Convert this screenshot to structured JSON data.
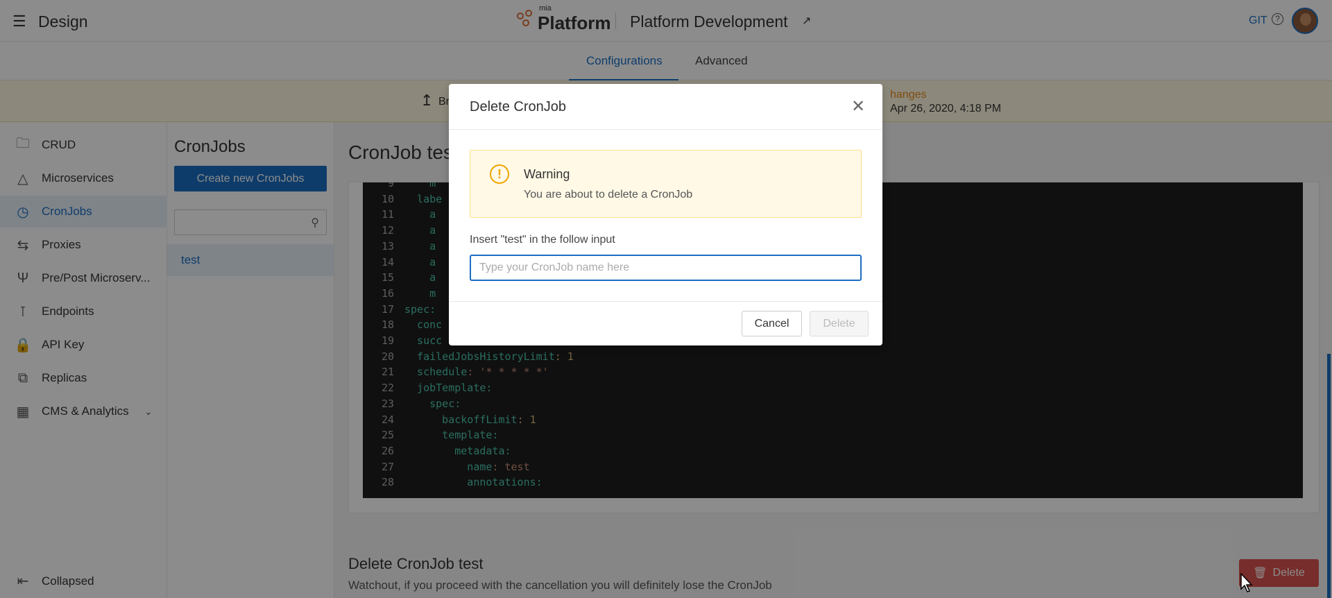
{
  "topbar": {
    "section": "Design",
    "brand_small": "mia",
    "brand": "Platform",
    "project": "Platform Development",
    "git": "GIT",
    "help": "?"
  },
  "tabs": [
    "Configurations",
    "Advanced"
  ],
  "banner": {
    "branch": "Br",
    "changes": "hanges",
    "date": "Apr 26, 2020, 4:18 PM"
  },
  "sidebar": {
    "items": [
      {
        "label": "CRUD",
        "icon": "folder-icon"
      },
      {
        "label": "Microservices",
        "icon": "microservices-icon"
      },
      {
        "label": "CronJobs",
        "icon": "clock-icon"
      },
      {
        "label": "Proxies",
        "icon": "proxy-icon"
      },
      {
        "label": "Pre/Post Microserv...",
        "icon": "fork-icon"
      },
      {
        "label": "Endpoints",
        "icon": "endpoint-icon"
      },
      {
        "label": "API Key",
        "icon": "lock-icon"
      },
      {
        "label": "Replicas",
        "icon": "copy-icon"
      },
      {
        "label": "CMS & Analytics",
        "icon": "cms-icon"
      }
    ],
    "collapsed": "Collapsed"
  },
  "cronjobs": {
    "title": "CronJobs",
    "create": "Create new CronJobs",
    "items": [
      "test"
    ]
  },
  "main": {
    "title": "CronJob tes",
    "delete_title": "Delete CronJob test",
    "delete_desc": "Watchout, if you proceed with the cancellation you will definitely lose the CronJob",
    "delete_button": "Delete"
  },
  "code": [
    {
      "n": "9",
      "indent": "    ",
      "key": "m",
      "val": ""
    },
    {
      "n": "10",
      "indent": "  ",
      "key": "labe",
      "val": ""
    },
    {
      "n": "11",
      "indent": "    ",
      "key": "a",
      "val": ""
    },
    {
      "n": "12",
      "indent": "    ",
      "key": "a",
      "val": ""
    },
    {
      "n": "13",
      "indent": "    ",
      "key": "a",
      "val": ""
    },
    {
      "n": "14",
      "indent": "    ",
      "key": "a",
      "val": ""
    },
    {
      "n": "15",
      "indent": "    ",
      "key": "a",
      "val": ""
    },
    {
      "n": "16",
      "indent": "    ",
      "key": "m",
      "val": ""
    },
    {
      "n": "17",
      "indent": "",
      "key": "spec:",
      "val": ""
    },
    {
      "n": "18",
      "indent": "  ",
      "key": "conc",
      "val": ""
    },
    {
      "n": "19",
      "indent": "  ",
      "key": "succ",
      "val": ""
    },
    {
      "n": "20",
      "indent": "  ",
      "key": "failedJobsHistoryLimit",
      "val": ": 1"
    },
    {
      "n": "21",
      "indent": "  ",
      "key": "schedule",
      "val": ": '* * * * *'"
    },
    {
      "n": "22",
      "indent": "  ",
      "key": "jobTemplate:",
      "val": ""
    },
    {
      "n": "23",
      "indent": "    ",
      "key": "spec:",
      "val": ""
    },
    {
      "n": "24",
      "indent": "      ",
      "key": "backoffLimit",
      "val": ": 1"
    },
    {
      "n": "25",
      "indent": "      ",
      "key": "template:",
      "val": ""
    },
    {
      "n": "26",
      "indent": "        ",
      "key": "metadata:",
      "val": ""
    },
    {
      "n": "27",
      "indent": "          ",
      "key": "name",
      "val": ": test"
    },
    {
      "n": "28",
      "indent": "          ",
      "key": "annotations:",
      "val": ""
    }
  ],
  "modal": {
    "title": "Delete CronJob",
    "warning_title": "Warning",
    "warning_text": "You are about to delete a CronJob",
    "label": "Insert \"test\" in the follow input",
    "placeholder": "Type your CronJob name here",
    "cancel": "Cancel",
    "delete": "Delete"
  }
}
